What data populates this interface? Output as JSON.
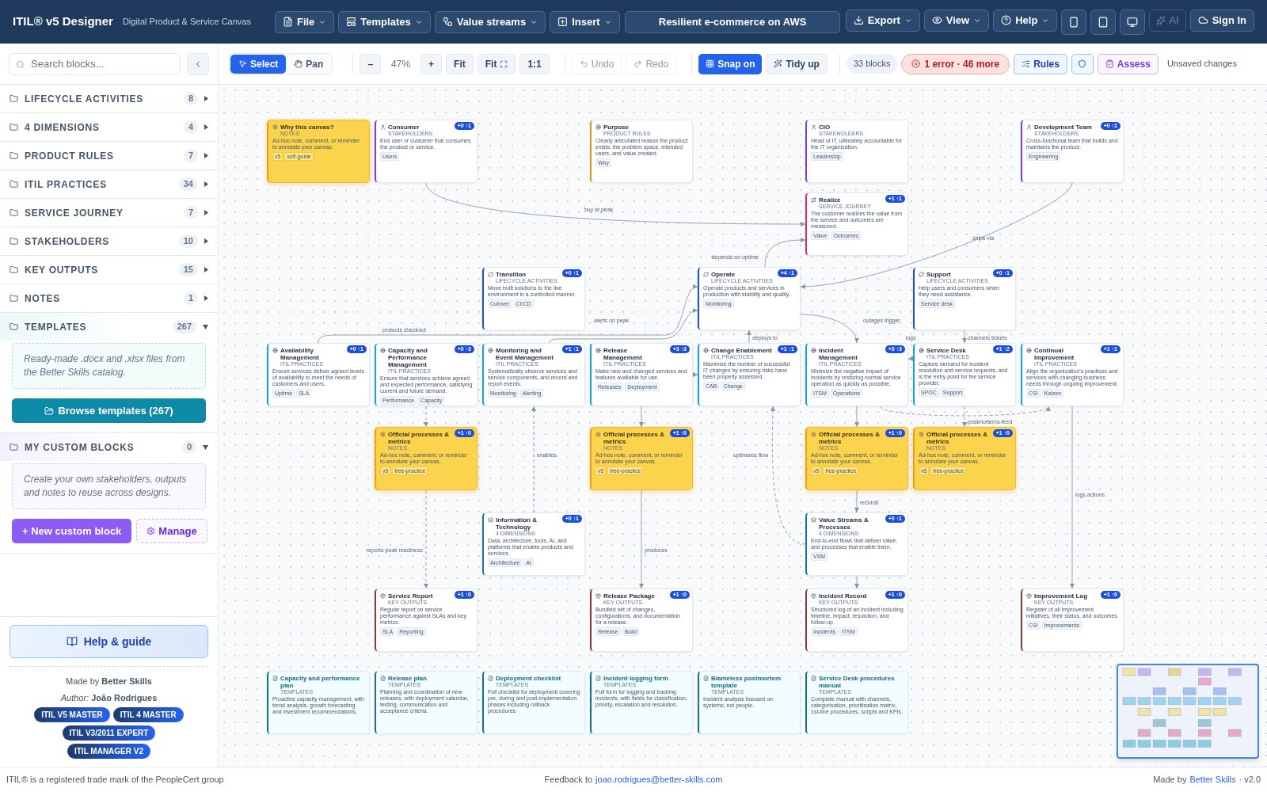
{
  "app": {
    "title": "ITIL® v5 Designer",
    "subtitle": "Digital Product & Service Canvas"
  },
  "menus": [
    {
      "label": "File",
      "kind": "file"
    },
    {
      "label": "Templates",
      "kind": "templates"
    },
    {
      "label": "Value streams",
      "kind": "streams"
    },
    {
      "label": "Insert",
      "kind": "insert"
    }
  ],
  "document_title": "Resilient e-commerce on AWS",
  "right_menus": [
    {
      "label": "Export",
      "kind": "export"
    },
    {
      "label": "View",
      "kind": "view"
    },
    {
      "label": "Help",
      "kind": "help"
    }
  ],
  "icon_buttons": [
    {
      "kind": "phone"
    },
    {
      "kind": "tablet"
    },
    {
      "kind": "screen"
    }
  ],
  "ai_button": {
    "label": "AI",
    "disabled": true
  },
  "sign_in": {
    "label": "Sign In"
  },
  "search": {
    "placeholder": "Search blocks..."
  },
  "tools": [
    {
      "label": "Select",
      "selected": true
    },
    {
      "label": "Pan",
      "selected": false
    }
  ],
  "zoom": {
    "out": "–",
    "level_text": "47%",
    "in": "+"
  },
  "view_buttons": [
    {
      "label": "Fit",
      "kind": "text"
    },
    {
      "label": "Fit",
      "kind": "icon"
    },
    {
      "label": "1:1",
      "kind": "text"
    }
  ],
  "history": [
    {
      "label": "Undo",
      "kind": "undo",
      "disabled": true
    },
    {
      "label": "Redo",
      "kind": "redo",
      "disabled": true
    }
  ],
  "snap": {
    "label": "Snap on",
    "on": true
  },
  "tidy": {
    "label": "Tidy up"
  },
  "block_count": "33 blocks",
  "issues": {
    "label": "1 error · 46 more"
  },
  "rules": {
    "label": "Rules"
  },
  "assess": {
    "label": "Assess"
  },
  "save_status": "Unsaved changes",
  "categories": [
    {
      "label": "LIFECYCLE ACTIVITIES",
      "count": "8",
      "expanded": false
    },
    {
      "label": "4 DIMENSIONS",
      "count": "4",
      "expanded": false
    },
    {
      "label": "PRODUCT RULES",
      "count": "7",
      "expanded": false
    },
    {
      "label": "ITIL PRACTICES",
      "count": "34",
      "expanded": false
    },
    {
      "label": "SERVICE JOURNEY",
      "count": "7",
      "expanded": false
    },
    {
      "label": "STAKEHOLDERS",
      "count": "10",
      "expanded": false
    },
    {
      "label": "KEY OUTPUTS",
      "count": "15",
      "expanded": false
    },
    {
      "label": "NOTES",
      "count": "1",
      "expanded": false
    },
    {
      "label": "TEMPLATES",
      "count": "267",
      "expanded": true,
      "kind": "templates",
      "note": "Ready-made .docx and .xlsx files from the Better Skills catalog.",
      "actions": [
        {
          "label": "Browse templates (267)",
          "kind": "browse"
        }
      ]
    },
    {
      "label": "MY CUSTOM BLOCKS",
      "count": "0",
      "expanded": true,
      "kind": "custom",
      "note": "Create your own stakeholders, outputs and notes to reuse across designs.",
      "actions": [
        {
          "label": "+ New custom block",
          "kind": "new"
        },
        {
          "label": "Manage",
          "kind": "manage"
        }
      ]
    }
  ],
  "help_button": {
    "label": "Help & guide"
  },
  "credits": {
    "made_by": "Made by **Better Skills**",
    "author": "*Author:* **João Rodrigues**",
    "badges": [
      "ITIL V5 MASTER",
      "ITIL 4 MASTER",
      "ITIL V3/2011 EXPERT",
      "ITIL MANAGER V2"
    ]
  },
  "nodes": [
    {
      "kind": "note",
      "title": "Why this canvas?",
      "category": "NOTES",
      "text": "Ad-hoc note, comment, or reminder to annotate your canvas.",
      "tags": [
        "v5",
        "self-guide"
      ]
    },
    {
      "kind": "stakeholder",
      "title": "Consumer",
      "category": "STAKEHOLDERS",
      "text": "End user or customer that consumes the product or service.",
      "tags": [
        "Users"
      ],
      "badge": "+0 ↑1"
    },
    {
      "kind": "rule",
      "title": "Purpose",
      "category": "PRODUCT RULES",
      "text": "Clearly articulated reason the product exists: the problem space, intended users, and value created.",
      "tags": [
        "Why"
      ]
    },
    {
      "kind": "stakeholder",
      "title": "CIO",
      "category": "STAKEHOLDERS",
      "text": "Head of IT, ultimately accountable for the IT organization.",
      "tags": [
        "Leadership"
      ]
    },
    {
      "kind": "stakeholder",
      "title": "Development Team",
      "category": "STAKEHOLDERS",
      "text": "Cross-functional team that builds and maintains the product.",
      "tags": [
        "Engineering"
      ],
      "badge": "+0 ↑1"
    },
    {
      "kind": "journey",
      "title": "Realize",
      "category": "SERVICE JOURNEY",
      "text": "The customer realizes the value from the service and outcomes are measured.",
      "tags": [
        "Value",
        "Outcomes"
      ],
      "badge": "+1 ↑1"
    },
    {
      "kind": "lifecycle",
      "title": "Transition",
      "category": "LIFECYCLE ACTIVITIES",
      "text": "Move built solutions to the live environment in a controlled manner.",
      "tags": [
        "Cutover",
        "CI/CD"
      ],
      "badge": "+0 ↑1"
    },
    {
      "kind": "lifecycle",
      "title": "Operate",
      "category": "LIFECYCLE ACTIVITIES",
      "text": "Operate products and services in production with stability and quality.",
      "tags": [
        "Monitoring"
      ],
      "badge": "+4 ↑1"
    },
    {
      "kind": "lifecycle",
      "title": "Support",
      "category": "LIFECYCLE ACTIVITIES",
      "text": "Help users and consumers when they need assistance.",
      "tags": [
        "Service desk"
      ],
      "badge": "+0 ↑1"
    },
    {
      "kind": "practice",
      "title": "Availability Management",
      "category": "ITIL PRACTICES",
      "text": "Ensure services deliver agreed levels of availability to meet the needs of customers and users.",
      "tags": [
        "Uptime",
        "SLA"
      ],
      "badge": "+0 ↑1"
    },
    {
      "kind": "practice",
      "title": "Capacity and Performance Management",
      "category": "ITIL PRACTICES",
      "text": "Ensure that services achieve agreed and expected performance, satisfying current and future demand.",
      "tags": [
        "Performance",
        "Capacity"
      ],
      "badge": "+0 ↑3"
    },
    {
      "kind": "practice",
      "title": "Monitoring and Event Management",
      "category": "ITIL PRACTICES",
      "text": "Systematically observe services and service components, and record and report events.",
      "tags": [
        "Monitoring",
        "Alerting"
      ],
      "badge": "+1 ↑1"
    },
    {
      "kind": "practice",
      "title": "Release Management",
      "category": "ITIL PRACTICES",
      "text": "Make new and changed services and features available for use.",
      "tags": [
        "Releases",
        "Deployment"
      ],
      "badge": "+3 ↑3"
    },
    {
      "kind": "practice",
      "title": "Change Enablement",
      "category": "ITIL PRACTICES",
      "text": "Maximize the number of successful IT changes by ensuring risks have been properly assessed.",
      "tags": [
        "CAB",
        "Change"
      ],
      "badge": "+1 ↑1"
    },
    {
      "kind": "practice",
      "title": "Incident Management",
      "category": "ITIL PRACTICES",
      "text": "Minimize the negative impact of incidents by restoring normal service operation as quickly as possible.",
      "tags": [
        "ITSM",
        "Operations"
      ],
      "badge": "+3 ↑3"
    },
    {
      "kind": "practice",
      "title": "Service Desk",
      "category": "ITIL PRACTICES",
      "text": "Capture demand for incident resolution and service requests, and is the entry point for the service provider.",
      "tags": [
        "SPOC",
        "Support"
      ],
      "badge": "+1 ↑2"
    },
    {
      "kind": "practice",
      "title": "Continual Improvement",
      "category": "ITIL PRACTICES",
      "text": "Align the organization's practices and services with changing business needs through ongoing improvement.",
      "tags": [
        "CSI",
        "Kaizen"
      ],
      "badge": "+1 ↑1"
    },
    {
      "kind": "note",
      "title": "Official processes & metrics",
      "category": "NOTES",
      "text": "Ad-hoc note, comment, or reminder to annotate your canvas.",
      "tags": [
        "v5",
        "free-practice"
      ],
      "badge": "+1 ↑0"
    },
    {
      "kind": "note",
      "title": "Official processes & metrics",
      "category": "NOTES",
      "text": "Ad-hoc note, comment, or reminder to annotate your canvas.",
      "tags": [
        "v5",
        "free-practice"
      ],
      "badge": "+1 ↑0"
    },
    {
      "kind": "note",
      "title": "Official processes & metrics",
      "category": "NOTES",
      "text": "Ad-hoc note, comment, or reminder to annotate your canvas.",
      "tags": [
        "v5",
        "free-practice"
      ],
      "badge": "+1 ↑0"
    },
    {
      "kind": "note",
      "title": "Official processes & metrics",
      "category": "NOTES",
      "text": "Ad-hoc note, comment, or reminder to annotate your canvas.",
      "tags": [
        "v5",
        "free-practice"
      ],
      "badge": "+1 ↑0"
    },
    {
      "kind": "dimension",
      "title": "Information & Technology",
      "category": "4 DIMENSIONS",
      "text": "Data, architecture, tools, AI, and platforms that enable products and services.",
      "tags": [
        "Architecture",
        "AI"
      ],
      "badge": "+0 ↑1"
    },
    {
      "kind": "dimension",
      "title": "Value Streams & Processes",
      "category": "4 DIMENSIONS",
      "text": "End-to-end flows that deliver value, and processes that enable them.",
      "tags": [
        "VSM"
      ],
      "badge": "+0 ↑1"
    },
    {
      "kind": "output",
      "title": "Service Report",
      "category": "KEY OUTPUTS",
      "text": "Regular report on service performance against SLAs and key metrics.",
      "tags": [
        "SLA",
        "Reporting"
      ],
      "badge": "+1 ↑0"
    },
    {
      "kind": "output",
      "title": "Release Package",
      "category": "KEY OUTPUTS",
      "text": "Bundled set of changes, configurations, and documentation for a release.",
      "tags": [
        "Release",
        "Build"
      ],
      "badge": "+1 ↑0"
    },
    {
      "kind": "output",
      "title": "Incident Record",
      "category": "KEY OUTPUTS",
      "text": "Structured log of an incident including timeline, impact, resolution, and follow-up.",
      "tags": [
        "Incidents",
        "ITSM"
      ],
      "badge": "+1 ↑0"
    },
    {
      "kind": "output",
      "title": "Improvement Log",
      "category": "KEY OUTPUTS",
      "text": "Register of all improvement initiatives, their status, and outcomes.",
      "tags": [
        "CSI",
        "Improvements"
      ],
      "badge": "+1 ↑0"
    },
    {
      "kind": "template",
      "title": "Capacity and performance plan",
      "category": "TEMPLATES",
      "text": "Proactive capacity management, with trend analysis, growth forecasting and investment recommendations."
    },
    {
      "kind": "template",
      "title": "Release plan",
      "category": "TEMPLATES",
      "text": "Planning and coordination of new releases, with deployment calendar, testing, communication and acceptance criteria."
    },
    {
      "kind": "template",
      "title": "Deployment checklist",
      "category": "TEMPLATES",
      "text": "Full checklist for deployment covering pre, during and post-implementation phases including rollback procedures."
    },
    {
      "kind": "template",
      "title": "Incident logging form",
      "category": "TEMPLATES",
      "text": "Full form for logging and tracking incidents, with fields for classification, priority, escalation and resolution."
    },
    {
      "kind": "template",
      "title": "Blameless postmortem template",
      "category": "TEMPLATES",
      "text": "Incident analysis focused on systems, not people."
    },
    {
      "kind": "template",
      "title": "Service Desk procedures manual",
      "category": "TEMPLATES",
      "text": "Complete manual with channels, categorisation, prioritisation matrix, 1st-line procedures, scripts and KPIs."
    }
  ],
  "edges": [
    {
      "label": "buy at peak",
      "dashed": false
    },
    {
      "label": "depends on uptime",
      "dashed": false
    },
    {
      "label": "ships via",
      "dashed": false
    },
    {
      "label": "protects checkout",
      "dashed": false
    },
    {
      "label": "alerts on peak",
      "dashed": false
    },
    {
      "label": "deploys to",
      "dashed": false
    },
    {
      "label": "outages trigger",
      "dashed": false
    },
    {
      "label": "logs",
      "dashed": false
    },
    {
      "label": "channels tickets",
      "dashed": false
    },
    {
      "label": "postmortems feed",
      "dashed": true
    },
    {
      "label": "enables",
      "dashed": true
    },
    {
      "label": "optimizes flow",
      "dashed": true
    },
    {
      "label": "reports peak readiness",
      "dashed": true
    },
    {
      "label": "produces",
      "dashed": false
    },
    {
      "label": "records",
      "dashed": false
    },
    {
      "label": "logs actions",
      "dashed": false
    },
    {
      "dashed": true
    },
    {
      "dashed": false
    },
    {
      "dashed": false
    },
    {
      "dashed": true
    },
    {
      "dashed": false
    },
    {
      "dashed": false
    }
  ],
  "footer": {
    "trademark": "ITIL® is a registered trade mark of the PeopleCert group",
    "feedback": "Feedback to",
    "email": "joao.rodrigues@better-skills.com",
    "made_by": "Made by",
    "brand": "Better Skills",
    "version": "· v2.0"
  }
}
